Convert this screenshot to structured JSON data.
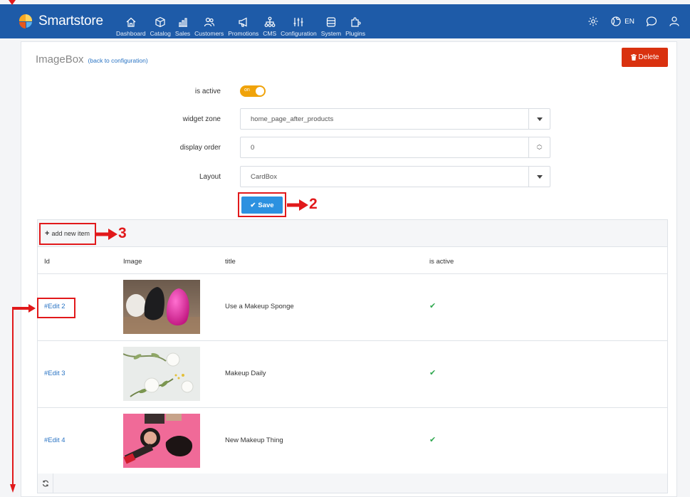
{
  "navbar": {
    "brand": "Smartstore",
    "items": [
      {
        "label": "Dashboard",
        "icon": "home-icon"
      },
      {
        "label": "Catalog",
        "icon": "box-icon"
      },
      {
        "label": "Sales",
        "icon": "chart-icon"
      },
      {
        "label": "Customers",
        "icon": "users-icon"
      },
      {
        "label": "Promotions",
        "icon": "megaphone-icon"
      },
      {
        "label": "CMS",
        "icon": "sitemap-icon"
      },
      {
        "label": "Configuration",
        "icon": "sliders-icon"
      },
      {
        "label": "System",
        "icon": "database-icon"
      },
      {
        "label": "Plugins",
        "icon": "puzzle-icon"
      }
    ],
    "language": "EN"
  },
  "page": {
    "title": "ImageBox",
    "back_link": "(back to configuration)",
    "delete_label": "Delete"
  },
  "form": {
    "is_active_label": "is active",
    "is_active_toggle": "on",
    "widget_zone_label": "widget zone",
    "widget_zone_value": "home_page_after_products",
    "display_order_label": "display order",
    "display_order_value": "0",
    "layout_label": "Layout",
    "layout_value": "CardBox",
    "save_label": "Save"
  },
  "annotations": {
    "save_step": "2",
    "add_step": "3"
  },
  "grid": {
    "add_new_item": "add new item",
    "columns": [
      "Id",
      "Image",
      "title",
      "is active"
    ],
    "rows": [
      {
        "id": "#Edit 2",
        "title": "Use a Makeup Sponge",
        "active": "✔"
      },
      {
        "id": "#Edit 3",
        "title": "Makeup Daily",
        "active": "✔"
      },
      {
        "id": "#Edit 4",
        "title": "New Makeup Thing",
        "active": "✔"
      }
    ]
  },
  "colors": {
    "navbar": "#1e5ba8",
    "accent_orange": "#f0a30a",
    "save_blue": "#2c91e0",
    "delete_red": "#d9310f",
    "annotation_red": "#e1191b",
    "check_green": "#2fa84f"
  }
}
